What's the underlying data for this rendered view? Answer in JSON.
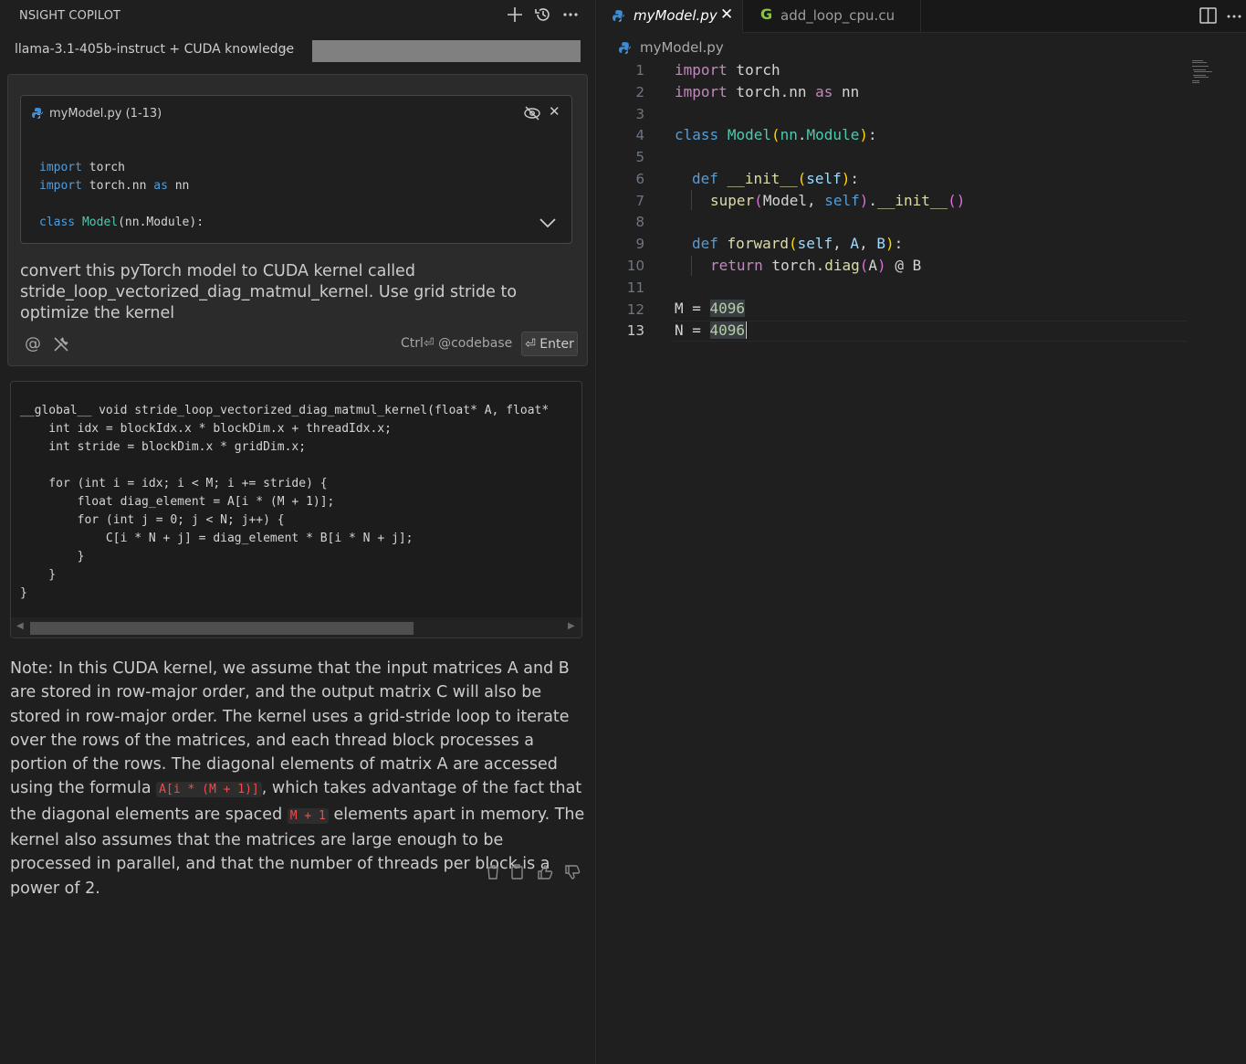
{
  "copilot": {
    "title": "NSIGHT COPILOT",
    "model": "llama-3.1-405b-instruct + CUDA knowledge",
    "context_card": {
      "title": "myModel.py (1-13)",
      "code": [
        "import torch",
        "import torch.nn as nn",
        "",
        "class Model(nn.Module):"
      ]
    },
    "prompt": "convert this pyTorch model to CUDA kernel called stride_loop_vectorized_diag_matmul_kernel. Use grid stride to optimize the kernel",
    "ctrl_hint": "Ctrl⏎ @codebase",
    "enter_label": "⏎ Enter",
    "code_block": "__global__ void stride_loop_vectorized_diag_matmul_kernel(float* A, float*\n    int idx = blockIdx.x * blockDim.x + threadIdx.x;\n    int stride = blockDim.x * gridDim.x;\n\n    for (int i = idx; i < M; i += stride) {\n        float diag_element = A[i * (M + 1)];\n        for (int j = 0; j < N; j++) {\n            C[i * N + j] = diag_element * B[i * N + j];\n        }\n    }\n}",
    "note": {
      "part1": "Note: In this CUDA kernel, we assume that the input matrices A and B are stored in row-major order, and the output matrix C will also be stored in row-major order. The kernel uses a grid-stride loop to iterate over the rows of the matrices, and each thread block processes a portion of the rows. The diagonal elements of matrix A are accessed using the formula ",
      "code1": "A[i * (M + 1)]",
      "part2": ", which takes advantage of the fact that the diagonal elements are spaced ",
      "code2": "M + 1",
      "part3": " elements apart in memory. The kernel also assumes that the matrices are large enough to be processed in parallel, and that the number of threads per block is a power of 2."
    }
  },
  "editor": {
    "tabs": [
      {
        "label": "myModel.py",
        "icon": "python-icon",
        "active": true
      },
      {
        "label": "add_loop_cpu.cu",
        "icon": "cuda-icon",
        "active": false
      }
    ],
    "breadcrumb": "myModel.py",
    "line_numbers": [
      "1",
      "2",
      "3",
      "4",
      "5",
      "6",
      "7",
      "8",
      "9",
      "10",
      "11",
      "12",
      "13"
    ],
    "active_line": "13"
  },
  "colors": {
    "background": "#1f1f1f",
    "keyword": "#c586c0",
    "builtin": "#569cd6",
    "class": "#4ec9b0",
    "function": "#dcdcaa",
    "number": "#b5cea8",
    "inline_code": "#f14c4c"
  }
}
